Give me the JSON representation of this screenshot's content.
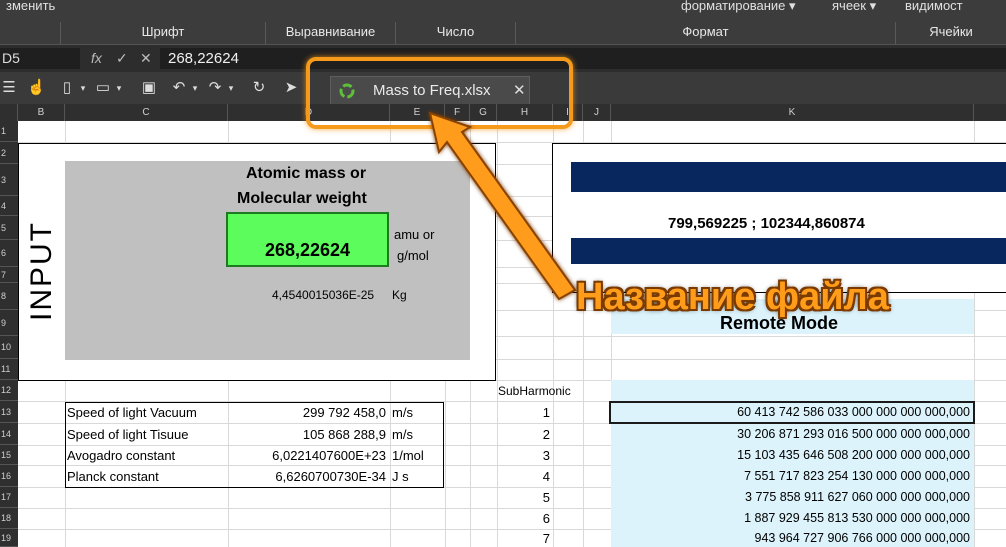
{
  "ribbon": {
    "top_items": [
      "зменить",
      "форматирование ▾",
      "ячеек ▾",
      "видимост"
    ],
    "groups": [
      "Шрифт",
      "Выравнивание",
      "Число",
      "Формат",
      "Ячейки"
    ],
    "left_fragment": ""
  },
  "formula_bar": {
    "name_box": "D5",
    "fx": "fx",
    "check": "✓",
    "cross": "✕",
    "value": "268,22624"
  },
  "file_tab": {
    "title": "Mass to Freq.xlsx",
    "close": "✕"
  },
  "columns": [
    "B",
    "C",
    "D",
    "E",
    "F",
    "G",
    "H",
    "I",
    "J",
    "K"
  ],
  "rows": [
    "1",
    "2",
    "3",
    "4",
    "5",
    "6",
    "7",
    "8",
    "9",
    "10",
    "11",
    "12",
    "13",
    "14",
    "15",
    "16",
    "17",
    "18",
    "19"
  ],
  "input_block": {
    "label": "INPUT",
    "heading_line1": "Atomic mass or",
    "heading_line2": "Molecular weight",
    "mass_value": "268,22624",
    "unit_line1": "amu or",
    "unit_line2": "g/mol",
    "kg_value": "4,4540015036E-25",
    "kg_unit": "Kg"
  },
  "result_block": {
    "value": "799,569225  ;  102344,860874",
    "mode": "Remote Mode"
  },
  "constants": [
    {
      "name": "Speed of light Vacuum",
      "value": "299 792 458,0",
      "unit": "m/s"
    },
    {
      "name": "Speed of light Tisuue",
      "value": "105 868 288,9",
      "unit": "m/s"
    },
    {
      "name": "Avogadro constant",
      "value": "6,0221407600E+23",
      "unit": "1/mol"
    },
    {
      "name": "Planck constant",
      "value": "6,6260700730E-34",
      "unit": "J s"
    }
  ],
  "subharmonic": {
    "header": "SubHarmonic",
    "items": [
      {
        "n": "1",
        "value": "60 413 742 586 033 000 000 000 000,000"
      },
      {
        "n": "2",
        "value": "30 206 871 293 016 500 000 000 000,000"
      },
      {
        "n": "3",
        "value": "15 103 435 646 508 200 000 000 000,000"
      },
      {
        "n": "4",
        "value": "7 551 717 823 254 130 000 000 000,000"
      },
      {
        "n": "5",
        "value": "3 775 858 911 627 060 000 000 000,000"
      },
      {
        "n": "6",
        "value": "1 887 929 455 813 530 000 000 000,000"
      },
      {
        "n": "7",
        "value": "943 964 727 906 766 000 000 000,000"
      }
    ]
  },
  "annotation": {
    "label": "Название файла",
    "color": "#ff9c1a"
  }
}
